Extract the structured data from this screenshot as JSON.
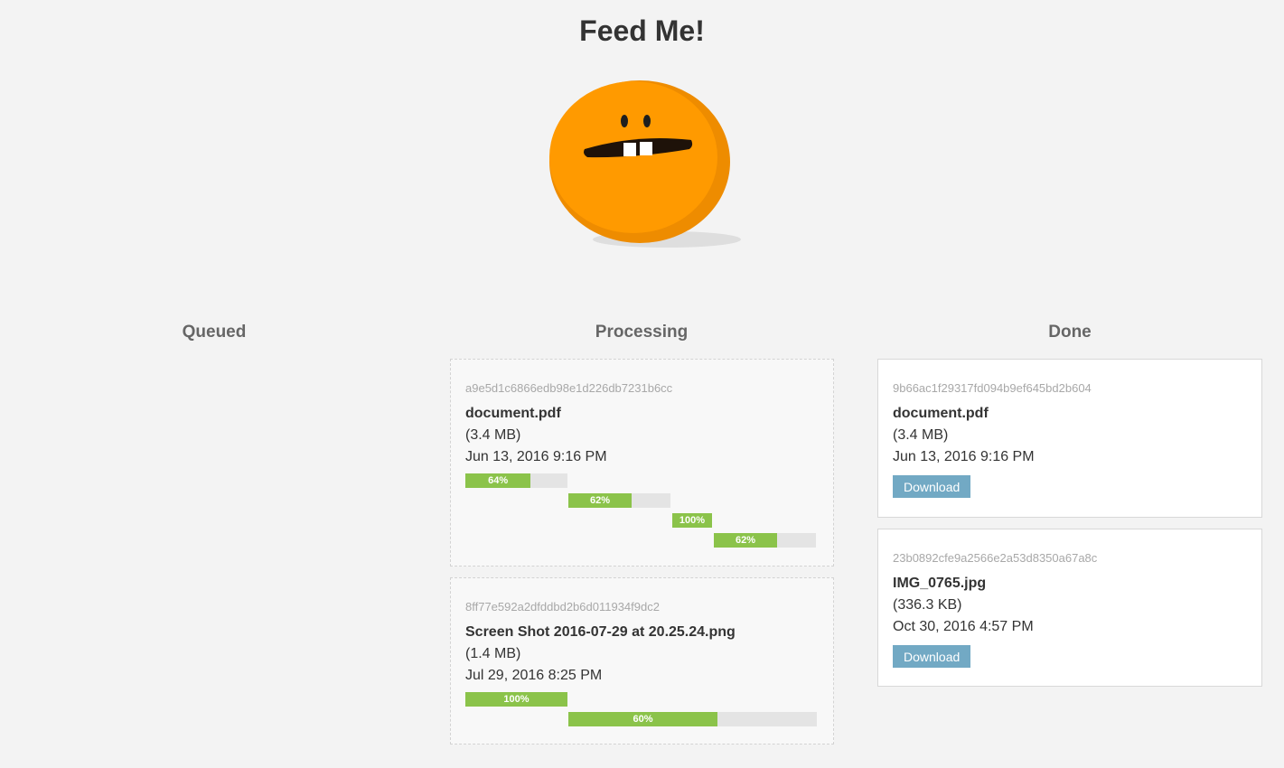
{
  "title": "Feed Me!",
  "columns": {
    "queued": "Queued",
    "processing": "Processing",
    "done": "Done"
  },
  "colors": {
    "mascot": "#ff9a00",
    "progress": "#8bc34a",
    "download_button": "#72a9c4"
  },
  "processing": [
    {
      "hash": "a9e5d1c6866edb98e1d226db7231b6cc",
      "name": "document.pdf",
      "size": "(3.4 MB)",
      "date": "Jun 13, 2016 9:16 PM",
      "progress": [
        {
          "value": 64,
          "label": "64%"
        },
        {
          "value": 62,
          "label": "62%"
        },
        {
          "value": 100,
          "label": "100%"
        },
        {
          "value": 62,
          "label": "62%"
        }
      ]
    },
    {
      "hash": "8ff77e592a2dfddbd2b6d011934f9dc2",
      "name": "Screen Shot 2016-07-29 at 20.25.24.png",
      "size": "(1.4 MB)",
      "date": "Jul 29, 2016 8:25 PM",
      "progress": [
        {
          "value": 100,
          "label": "100%"
        },
        {
          "value": 60,
          "label": "60%"
        }
      ]
    }
  ],
  "done": [
    {
      "hash": "9b66ac1f29317fd094b9ef645bd2b604",
      "name": "document.pdf",
      "size": "(3.4 MB)",
      "date": "Jun 13, 2016 9:16 PM",
      "button": "Download"
    },
    {
      "hash": "23b0892cfe9a2566e2a53d8350a67a8c",
      "name": "IMG_0765.jpg",
      "size": "(336.3 KB)",
      "date": "Oct 30, 2016 4:57 PM",
      "button": "Download"
    }
  ]
}
